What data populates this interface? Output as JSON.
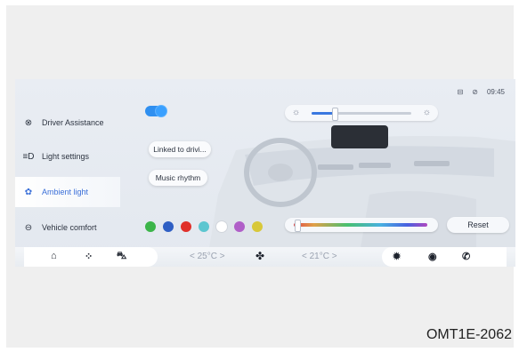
{
  "status_bar": {
    "icon1": "sim-icon",
    "icon2": "mute-icon",
    "time": "09:45"
  },
  "sidebar": {
    "items": [
      {
        "label": "Driver Assistance",
        "icon": "steering-icon",
        "glyph": "⊗"
      },
      {
        "label": "Light settings",
        "icon": "headlight-icon",
        "glyph": "≡D"
      },
      {
        "label": "Ambient light",
        "icon": "ambient-light-icon",
        "glyph": "✿"
      },
      {
        "label": "Vehicle comfort",
        "icon": "seat-icon",
        "glyph": "⊖"
      }
    ]
  },
  "ambient": {
    "enabled": true,
    "linked_label": "Linked to drivi...",
    "music_label": "Music rhythm",
    "brightness_level": 0.22,
    "color_slider_level": 0.02,
    "reset_label": "Reset",
    "swatches": [
      "#3cb54a",
      "#2f5fc4",
      "#e0302a",
      "#5cc6d0",
      "#ffffff",
      "#b05fc8",
      "#d8c83a"
    ]
  },
  "bottom_bar": {
    "temp_left": "< 25°C >",
    "temp_right": "< 21°C >"
  },
  "caption": "OMT1E-2062"
}
